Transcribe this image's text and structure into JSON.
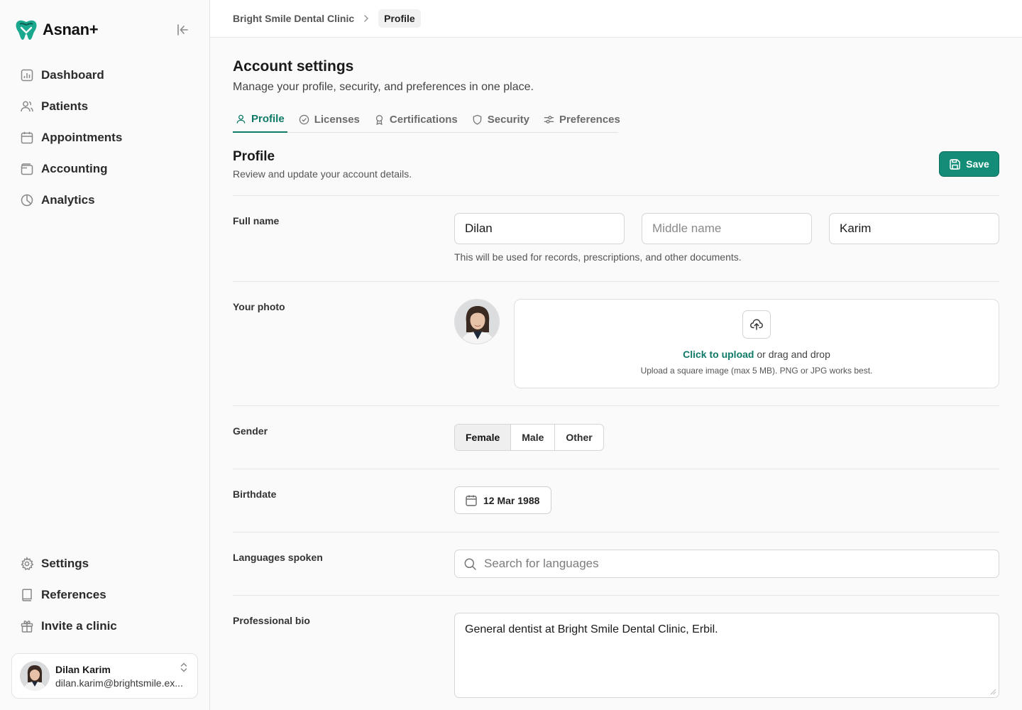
{
  "app": {
    "name": "Asnan+"
  },
  "sidebar": {
    "nav_top": [
      {
        "label": "Dashboard",
        "icon": "bar-chart-icon"
      },
      {
        "label": "Patients",
        "icon": "users-icon"
      },
      {
        "label": "Appointments",
        "icon": "calendar-icon"
      },
      {
        "label": "Accounting",
        "icon": "wallet-icon"
      },
      {
        "label": "Analytics",
        "icon": "pie-chart-icon"
      }
    ],
    "nav_bottom": [
      {
        "label": "Settings",
        "icon": "gear-icon"
      },
      {
        "label": "References",
        "icon": "book-icon"
      },
      {
        "label": "Invite a clinic",
        "icon": "gift-icon"
      }
    ],
    "user": {
      "name": "Dilan Karim",
      "email": "dilan.karim@brightsmile.ex..."
    }
  },
  "breadcrumb": {
    "parent": "Bright Smile Dental Clinic",
    "current": "Profile"
  },
  "page": {
    "title": "Account settings",
    "subtitle": "Manage your profile, security, and preferences in one place.",
    "tabs": [
      {
        "label": "Profile",
        "active": true
      },
      {
        "label": "Licenses",
        "active": false
      },
      {
        "label": "Certifications",
        "active": false
      },
      {
        "label": "Security",
        "active": false
      },
      {
        "label": "Preferences",
        "active": false
      }
    ]
  },
  "profile": {
    "title": "Profile",
    "subtitle": "Review and update your account details.",
    "save_label": "Save",
    "full_name": {
      "label": "Full name",
      "first": "Dilan",
      "middle_placeholder": "Middle name",
      "last": "Karim",
      "hint": "This will be used for records, prescriptions, and other documents."
    },
    "photo": {
      "label": "Your photo",
      "upload_link": "Click to upload",
      "upload_rest": " or drag and drop",
      "upload_hint": "Upload a square image (max 5 MB). PNG or JPG works best."
    },
    "gender": {
      "label": "Gender",
      "options": [
        "Female",
        "Male",
        "Other"
      ],
      "selected": "Female"
    },
    "birthdate": {
      "label": "Birthdate",
      "value": "12 Mar 1988"
    },
    "languages": {
      "label": "Languages spoken",
      "placeholder": "Search for languages"
    },
    "bio": {
      "label": "Professional bio",
      "value": "General dentist at Bright Smile Dental Clinic, Erbil."
    }
  },
  "colors": {
    "accent": "#138d78",
    "accent_text": "#0f7a68"
  }
}
